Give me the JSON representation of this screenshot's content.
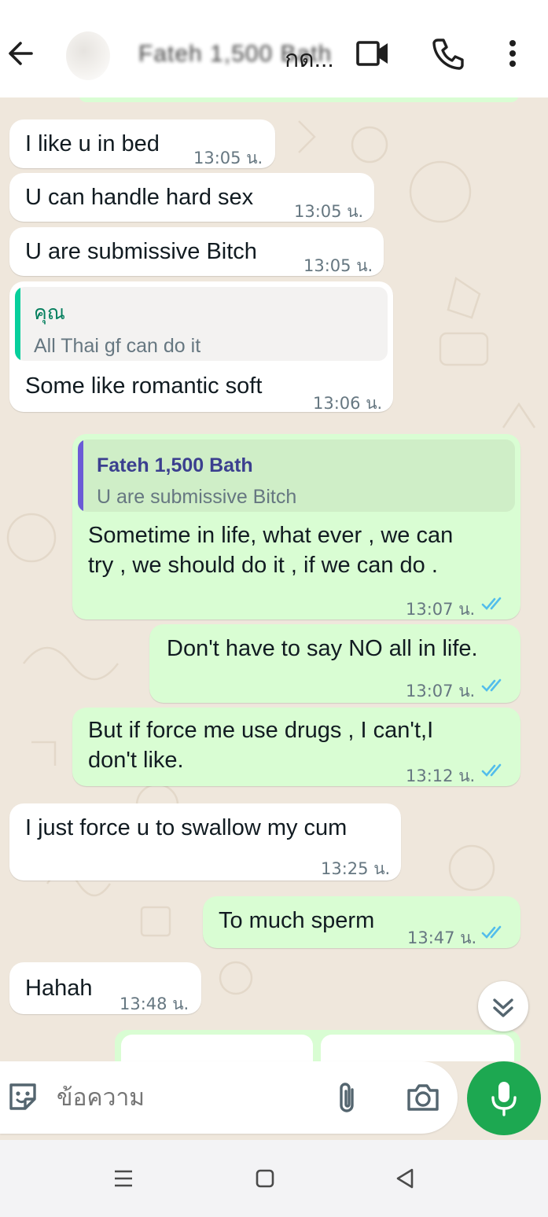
{
  "header": {
    "contact_name": "Fateh 1,500 Bath",
    "contact_name_visible": "กด...",
    "back_icon": "arrow-left-icon",
    "video_icon": "video-camera-icon",
    "call_icon": "phone-icon",
    "menu_icon": "more-vertical-icon"
  },
  "messages": [
    {
      "dir": "in",
      "text": "I like u in bed",
      "time": "13:05 น."
    },
    {
      "dir": "in",
      "text": "U can handle hard sex",
      "time": "13:05 น."
    },
    {
      "dir": "in",
      "text": "U are submissive Bitch",
      "time": "13:05 น."
    },
    {
      "dir": "in",
      "quote_author": "คุณ",
      "quote_text": "All Thai gf can do it",
      "text": "Some like romantic soft",
      "time": "13:06 น."
    },
    {
      "dir": "out",
      "quote_author": "Fateh 1,500 Bath",
      "quote_text": "U are submissive Bitch",
      "text_lines": [
        "Sometime in life, what ever , we can",
        "try ,  we should do it , if we can do ."
      ],
      "time": "13:07 น.",
      "status": "read"
    },
    {
      "dir": "out",
      "text": "Don't have to say NO all in life.",
      "time": "13:07 น.",
      "status": "read"
    },
    {
      "dir": "out",
      "text_lines": [
        "But if force me use drugs  ,  I can't,I",
        "don't like."
      ],
      "time": "13:12 น.",
      "status": "read"
    },
    {
      "dir": "in",
      "text": "I just force u to swallow my cum",
      "time": "13:25 น."
    },
    {
      "dir": "out",
      "text": "To much sperm",
      "time": "13:47 น.",
      "status": "read"
    },
    {
      "dir": "in",
      "text": "Hahah",
      "time": "13:48 น."
    }
  ],
  "composer": {
    "placeholder": "ข้อความ",
    "sticker_icon": "sticker-icon",
    "attach_icon": "paperclip-icon",
    "camera_icon": "camera-icon",
    "mic_icon": "microphone-icon"
  },
  "scroll_down_icon": "double-chevron-down-icon",
  "navbar": {
    "recents_icon": "menu-lines-icon",
    "home_icon": "square-icon",
    "back_icon": "triangle-back-icon"
  },
  "colors": {
    "incoming_bubble": "#ffffff",
    "outgoing_bubble": "#d9fdd3",
    "chat_background": "#efe7dc",
    "read_ticks": "#53bdeb",
    "quote_bar_self": "#06cf9c",
    "quote_bar_contact": "#6b5bd6",
    "mic_button": "#1da851"
  }
}
